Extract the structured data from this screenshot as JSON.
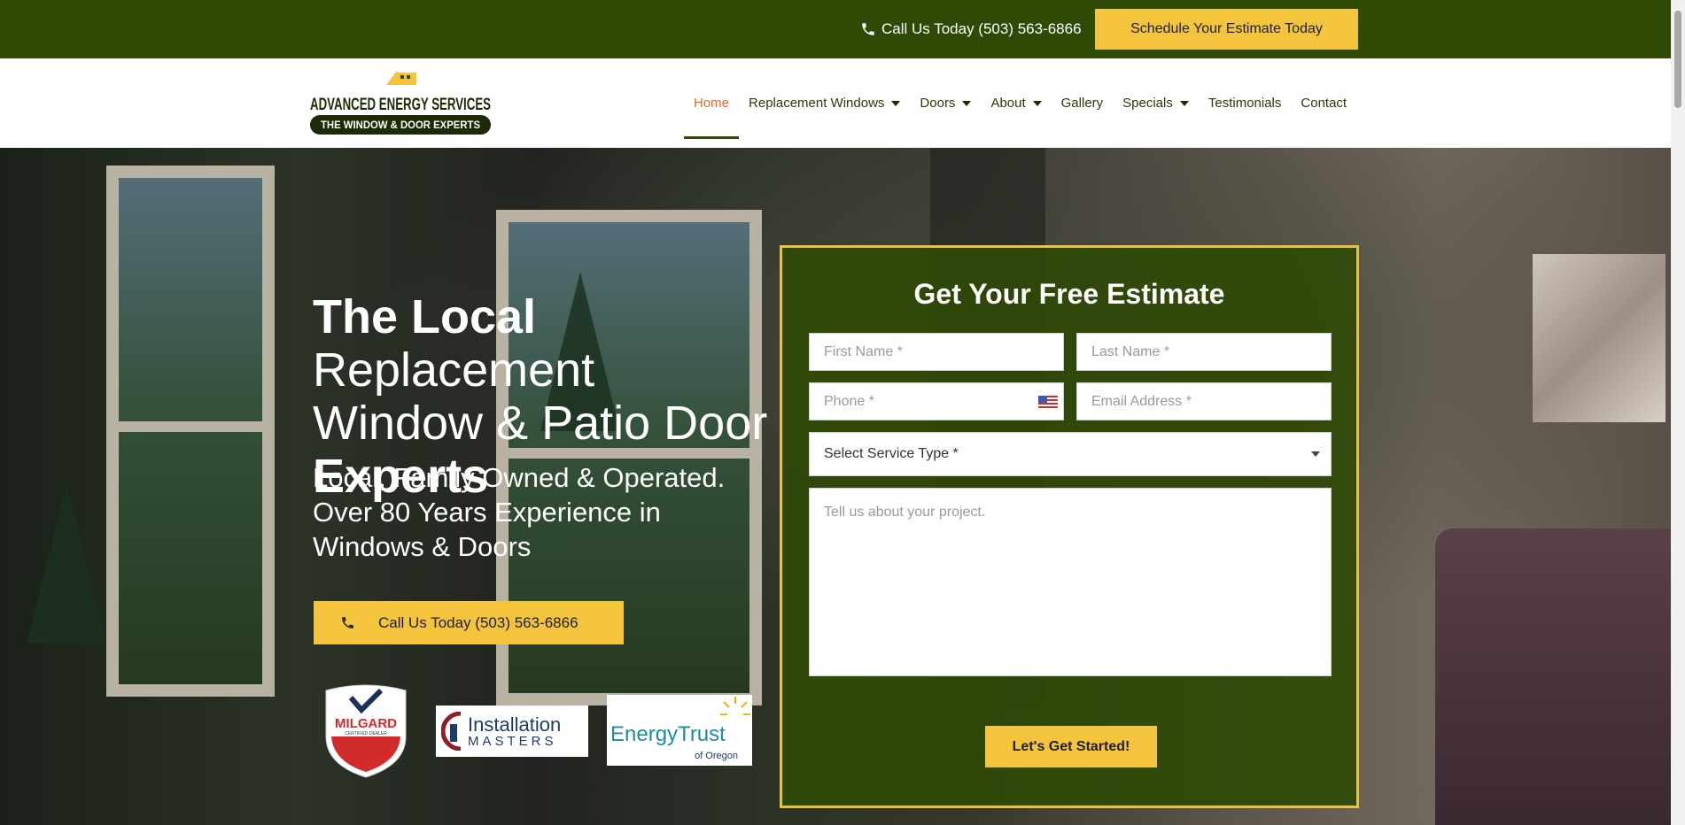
{
  "topbar": {
    "phone_label": "Call Us Today (503) 563-6866",
    "cta_label": "Schedule Your Estimate Today"
  },
  "logo": {
    "line1": "ADVANCED ENERGY SERVICES",
    "line2": "THE WINDOW & DOOR EXPERTS"
  },
  "nav": {
    "items": [
      {
        "label": "Home"
      },
      {
        "label": "Replacement Windows"
      },
      {
        "label": "Doors"
      },
      {
        "label": "About"
      },
      {
        "label": "Gallery"
      },
      {
        "label": "Specials"
      },
      {
        "label": "Testimonials"
      },
      {
        "label": "Contact"
      }
    ]
  },
  "hero": {
    "headline_bold1": "The Local",
    "headline_mid": "Replacement Window & Patio Door",
    "headline_bold2": "Experts",
    "subheadline": "Local, Family Owned & Operated. Over 80 Years Experience in Windows & Doors",
    "call_label": "Call Us Today (503) 563-6866"
  },
  "badges": {
    "milgard": "MILGARD",
    "milgard_sub": "CERTIFIED DEALER",
    "im_title": "Installation",
    "im_sub": "MASTERS",
    "et_title": "EnergyTrust",
    "et_sub": "of Oregon"
  },
  "form": {
    "title": "Get Your Free Estimate",
    "first_name_placeholder": "First Name *",
    "last_name_placeholder": "Last Name *",
    "phone_placeholder": "Phone *",
    "email_placeholder": "Email Address *",
    "service_select": "Select Service Type *",
    "message_placeholder": "Tell us about your project.",
    "submit_label": "Let's Get Started!"
  },
  "colors": {
    "brand_green": "#2f4a05",
    "accent_yellow": "#f4c43c",
    "active_orange": "#e46b22"
  }
}
